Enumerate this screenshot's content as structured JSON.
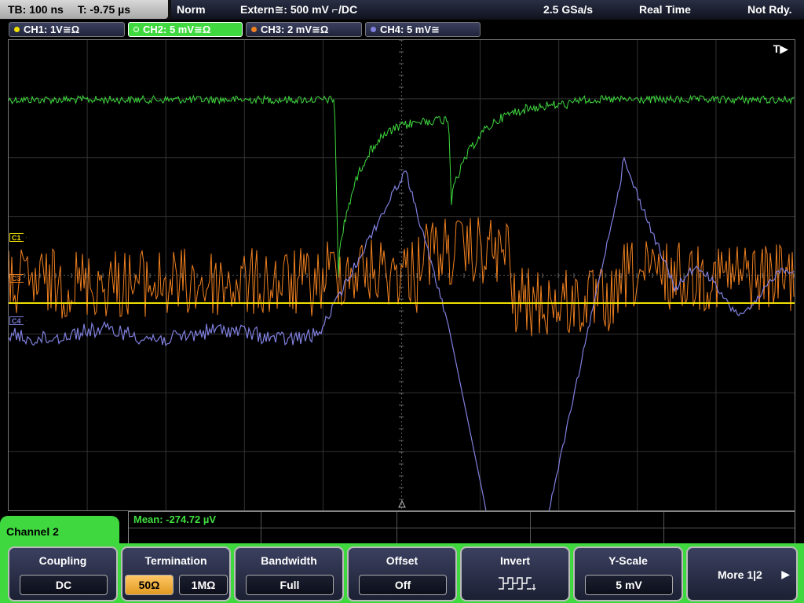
{
  "topbar": {
    "timebase": "TB: 100 ns",
    "time_pos": "T: -9.75 µs",
    "trigger_mode": "Norm",
    "trigger_source": "Extern≅: 500 mV ⌐/DC",
    "sample_rate": "2.5 GSa/s",
    "acq_mode": "Real Time",
    "status": "Not Rdy."
  },
  "channels": [
    {
      "label": "CH1: 1V≅Ω",
      "color": "#f0e000"
    },
    {
      "label": "CH2: 5 mV≅Ω",
      "color": "#3fd93f"
    },
    {
      "label": "CH3: 2 mV≅Ω",
      "color": "#f08020"
    },
    {
      "label": "CH4: 5 mV≅",
      "color": "#8080e0"
    }
  ],
  "screen": {
    "trigger_marker": "T▶",
    "labels": [
      "C1",
      "C3",
      "C4"
    ]
  },
  "measurement": {
    "text": "Mean: -274.72 µV"
  },
  "menu": {
    "tab_title": "Channel 2",
    "coupling": {
      "label": "Coupling",
      "value": "DC"
    },
    "termination": {
      "label": "Termination",
      "opt1": "50Ω",
      "opt2": "1MΩ"
    },
    "bandwidth": {
      "label": "Bandwidth",
      "value": "Full"
    },
    "offset": {
      "label": "Offset",
      "value": "Off"
    },
    "invert": {
      "label": "Invert"
    },
    "yscale": {
      "label": "Y-Scale",
      "value": "5 mV"
    },
    "more": {
      "label": "More 1|2",
      "arrow": "▶"
    }
  },
  "colors": {
    "ch1": "#f0e000",
    "ch2": "#3fd93f",
    "ch3": "#f08020",
    "ch4": "#8080e0",
    "menu_accent": "#3fd93f",
    "selected": "#f0a030"
  }
}
